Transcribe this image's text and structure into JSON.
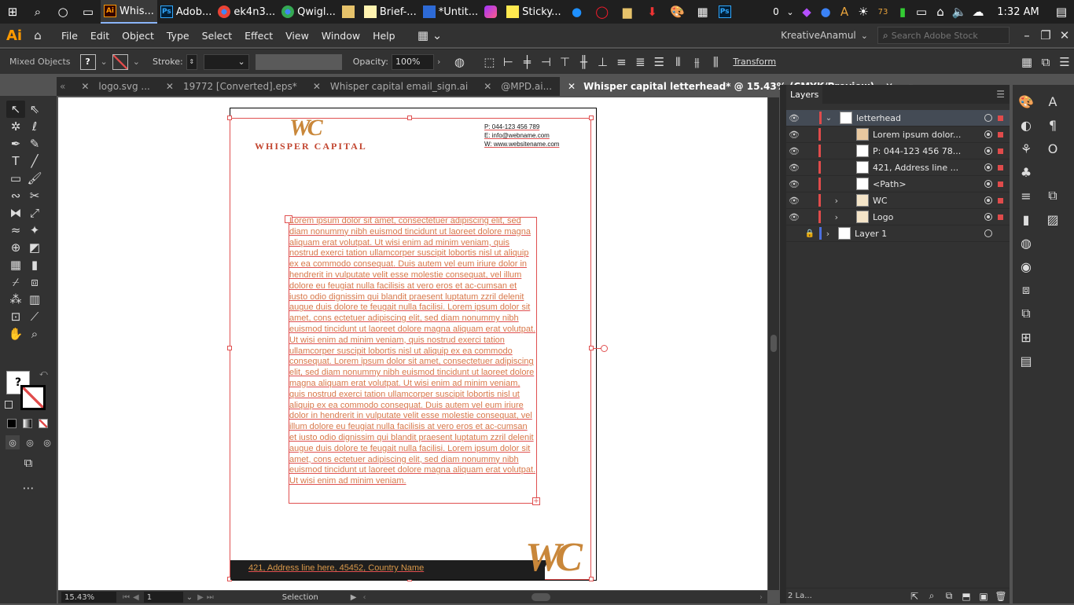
{
  "taskbar": {
    "apps": [
      {
        "label": "Whis...",
        "badge": "Ai",
        "active": true
      },
      {
        "label": "Adob...",
        "badge": "Ps",
        "active": false
      },
      {
        "label": "ek4n3...",
        "badge": "",
        "active": false
      },
      {
        "label": "Qwigl...",
        "badge": "",
        "active": false
      },
      {
        "label": "",
        "badge": "",
        "active": false
      },
      {
        "label": "Brief-...",
        "badge": "",
        "active": false
      },
      {
        "label": "*Untit...",
        "badge": "",
        "active": false
      },
      {
        "label": "",
        "badge": "",
        "active": false
      },
      {
        "label": "Sticky...",
        "badge": "",
        "active": false
      }
    ],
    "notif_count": "0",
    "badge_count": "73",
    "clock": "1:32 AM"
  },
  "menubar": {
    "logo": "Ai",
    "items": [
      "File",
      "Edit",
      "Object",
      "Type",
      "Select",
      "Effect",
      "View",
      "Window",
      "Help"
    ],
    "user": "KreativeAnamul",
    "search_placeholder": "Search Adobe Stock"
  },
  "control": {
    "selection_type": "Mixed Objects",
    "fill_value": "?",
    "stroke_label": "Stroke:",
    "opacity_label": "Opacity:",
    "opacity_value": "100%",
    "transform_label": "Transform"
  },
  "tabs": [
    {
      "label": "logo.svg ...",
      "active": false
    },
    {
      "label": "19772 [Converted].eps*",
      "active": false
    },
    {
      "label": "Whisper capital email_sign.ai",
      "active": false
    },
    {
      "label": "@MPD.ai...",
      "active": false
    },
    {
      "label": "Whisper capital letterhead* @ 15.43% (CMYK/Preview)",
      "active": true
    }
  ],
  "document": {
    "logo_mark": "WC",
    "company": "WHISPER CAPITAL",
    "contact": [
      "P: 044-123 456 789",
      "E: info@webname.com",
      "W: www.websitename.com"
    ],
    "body": "Lorem ipsum dolor sit amet, consectetuer adipiscing elit, sed diam nonummy nibh euismod tincidunt ut laoreet dolore magna aliquam erat volutpat. Ut wisi enim ad minim veniam, quis nostrud exerci tation ullamcorper suscipit lobortis nisl ut aliquip ex ea commodo consequat. Duis autem vel eum iriure dolor in hendrerit in vulputate velit esse molestie consequat, vel illum dolore eu feugiat nulla facilisis at vero eros et ac-cumsan et iusto odio dignissim qui blandit praesent luptatum zzril delenit augue duis dolore te feugait nulla facilisi. Lorem ipsum dolor sit amet, cons ectetuer adipiscing elit, sed diam nonummy nibh euismod tincidunt ut laoreet dolore magna aliquam erat volutpat. Ut wisi enim ad minim veniam, quis nostrud exerci tation ullamcorper suscipit lobortis nisl ut aliquip ex ea commodo consequat. Lorem ipsum dolor sit amet, consectetuer adipiscing elit, sed diam nonummy nibh euismod tincidunt ut laoreet dolore magna aliquam erat volutpat. Ut wisi enim ad minim veniam, quis nostrud exerci tation ullamcorper suscipit lobortis nisl ut aliquip ex ea commodo consequat. Duis autem vel eum iriure dolor in hendrerit in vulputate velit esse molestie consequat, vel illum dolore eu feugiat nulla facilisis at vero eros et ac-cumsan et iusto odio dignissim qui blandit praesent luptatum zzril delenit augue duis dolore te feugait nulla facilisi. Lorem ipsum dolor sit amet, cons ectetuer adipiscing elit, sed diam nonummy nibh euismod tincidunt ut laoreet dolore magna aliquam erat volutpat. Ut wisi enim ad minim veniam.",
    "address": "421, Address line here, 45452, Country Name",
    "footer_mark": "WC"
  },
  "layers": {
    "title": "Layers",
    "rows": [
      {
        "name": "letterhead",
        "selected": true
      },
      {
        "name": "Lorem ipsum dolor...",
        "selected": false
      },
      {
        "name": "P: 044-123 456 78...",
        "selected": false
      },
      {
        "name": "421, Address line ...",
        "selected": false
      },
      {
        "name": "<Path>",
        "selected": false
      },
      {
        "name": "WC",
        "selected": false
      },
      {
        "name": "Logo",
        "selected": false
      },
      {
        "name": "Layer 1",
        "selected": false
      }
    ],
    "footer_count": "2 La..."
  },
  "status": {
    "zoom": "15.43%",
    "page": "1",
    "tool": "Selection"
  },
  "colors": {
    "accent_red": "#e04b4b",
    "gold": "#c9873a",
    "text_orange": "#d8784a"
  }
}
